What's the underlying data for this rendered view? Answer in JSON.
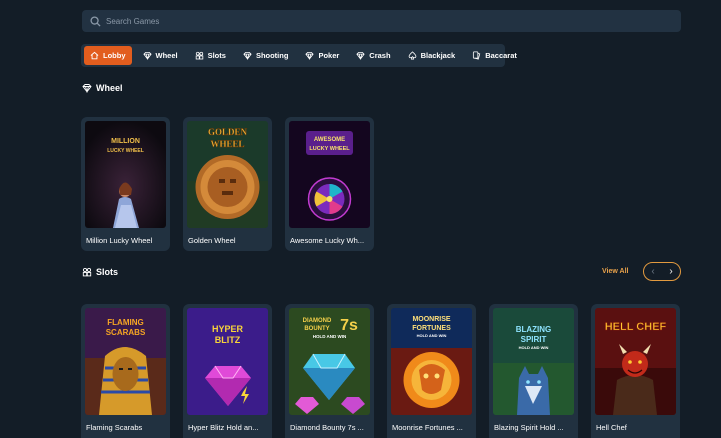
{
  "search": {
    "placeholder": "Search Games"
  },
  "tabs": [
    {
      "label": "Lobby",
      "icon": "home-icon",
      "active": true
    },
    {
      "label": "Wheel",
      "icon": "diamond-icon"
    },
    {
      "label": "Slots",
      "icon": "slots-icon"
    },
    {
      "label": "Shooting",
      "icon": "diamond-icon"
    },
    {
      "label": "Poker",
      "icon": "diamond-icon"
    },
    {
      "label": "Crash",
      "icon": "diamond-icon"
    },
    {
      "label": "Blackjack",
      "icon": "spade-icon"
    },
    {
      "label": "Baccarat",
      "icon": "cards-icon"
    }
  ],
  "wheel": {
    "title": "Wheel",
    "games": [
      {
        "name": "Million Lucky Wheel",
        "art_text": "MILLION LUCKY WHEEL"
      },
      {
        "name": "Golden Wheel",
        "art_text": "GOLDEN WHEEL"
      },
      {
        "name": "Awesome Lucky Wh...",
        "art_text": "AWESOME LUCKY WHEEL"
      }
    ]
  },
  "slots": {
    "title": "Slots",
    "view_all": "View All",
    "games": [
      {
        "name": "Flaming Scarabs",
        "art_text": "FLAMING SCARABS"
      },
      {
        "name": "Hyper Blitz Hold an...",
        "art_text": "HYPER BLITZ"
      },
      {
        "name": "Diamond Bounty 7s ...",
        "art_text": "DIAMOND BOUNTY 7s HOLD AND WIN"
      },
      {
        "name": "Moonrise Fortunes ...",
        "art_text": "MOONRISE FORTUNES HOLD AND WIN"
      },
      {
        "name": "Blazing Spirit Hold ...",
        "art_text": "BLAZING SPIRIT HOLD AND WIN"
      },
      {
        "name": "Hell Chef",
        "art_text": "HELL CHEF"
      }
    ]
  },
  "colors": {
    "background": "#131d27",
    "panel": "#213140",
    "accent": "#e25d1e",
    "view_all": "#e9a24b"
  }
}
